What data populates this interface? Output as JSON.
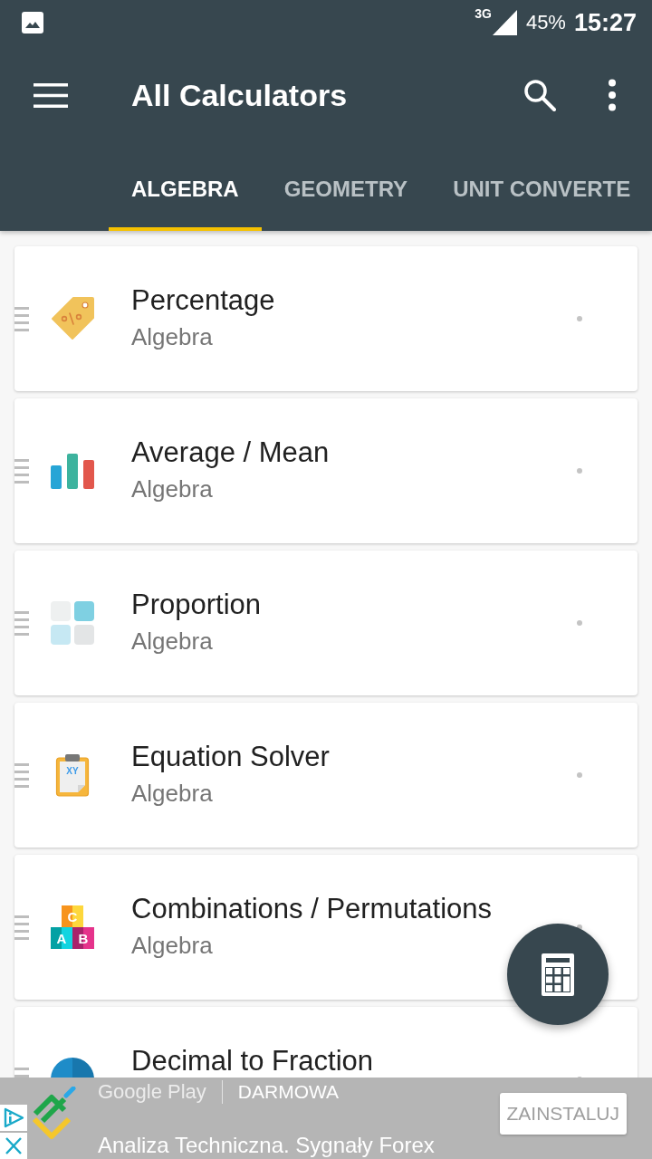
{
  "status_bar": {
    "network": "3G",
    "battery": "45%",
    "time": "15:27"
  },
  "app_bar": {
    "title": "All Calculators"
  },
  "tabs": [
    {
      "label": "ALGEBRA",
      "selected": true
    },
    {
      "label": "GEOMETRY",
      "selected": false
    },
    {
      "label": "UNIT CONVERTE",
      "selected": false
    }
  ],
  "calculators": [
    {
      "title": "Percentage",
      "category": "Algebra",
      "kind": "tag"
    },
    {
      "title": "Average / Mean",
      "category": "Algebra",
      "kind": "bars"
    },
    {
      "title": "Proportion",
      "category": "Algebra",
      "kind": "tiles"
    },
    {
      "title": "Equation Solver",
      "category": "Algebra",
      "kind": "clipboard",
      "icon_text": "XY"
    },
    {
      "title": "Combinations / Permutations",
      "category": "Algebra",
      "kind": "blocks",
      "icon_letters": [
        "C",
        "A",
        "B"
      ]
    },
    {
      "title": "Decimal to Fraction",
      "kind": "disc"
    }
  ],
  "ad": {
    "store": "Google Play",
    "price": "DARMOWA",
    "button": "ZAINSTALUJ",
    "headline": "Analiza Techniczna. Sygnały Forex"
  }
}
